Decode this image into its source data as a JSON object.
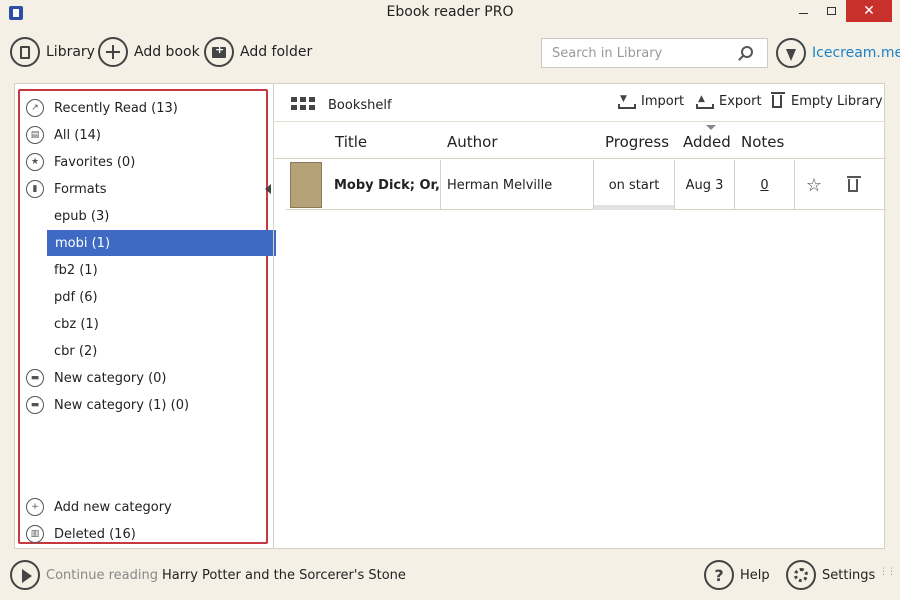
{
  "window": {
    "title": "Ebook reader PRO",
    "close_symbol": "✕"
  },
  "toolbar": {
    "library_label": "Library",
    "add_book_label": "Add book",
    "add_folder_label": "Add folder",
    "search_placeholder": "Search in Library",
    "brand_label": "Icecream.me"
  },
  "sidebar": {
    "items": [
      {
        "label": "Recently Read (13)",
        "icon": "share-icon"
      },
      {
        "label": "All (14)",
        "icon": "books-icon"
      },
      {
        "label": "Favorites (0)",
        "icon": "star-icon"
      },
      {
        "label": "Formats",
        "icon": "file-icon"
      },
      {
        "label": "epub (3)"
      },
      {
        "label": "mobi (1)"
      },
      {
        "label": "fb2 (1)"
      },
      {
        "label": "pdf (6)"
      },
      {
        "label": "cbz (1)"
      },
      {
        "label": "cbr (2)"
      },
      {
        "label": "New category (0)",
        "icon": "folder-icon"
      },
      {
        "label": "New category (1) (0)",
        "icon": "folder-icon"
      },
      {
        "label": "Add new category",
        "icon": "plus-icon"
      },
      {
        "label": "Deleted (16)",
        "icon": "trash-icon"
      }
    ],
    "selected_item": "mobi (1)"
  },
  "content": {
    "view_label": "Bookshelf",
    "import_label": "Import",
    "export_label": "Export",
    "empty_library_label": "Empty Library",
    "columns": [
      "Title",
      "Author",
      "Progress",
      "Added",
      "Notes"
    ],
    "books": [
      {
        "title": "Moby Dick; Or,",
        "author": "Herman Melville",
        "progress": "on start",
        "added": "Aug 3",
        "notes": "0"
      }
    ]
  },
  "statusbar": {
    "continue_label": "Continue reading",
    "current_book": "Harry Potter and the Sorcerer's Stone",
    "help_label": "Help",
    "settings_label": "Settings"
  },
  "colors": {
    "accent_selected": "#3f6ac4",
    "sidebar_highlight_border": "#c5383f",
    "close_button": "#c7302b",
    "brand_link": "#1a82c4",
    "background": "#f5f0e6"
  }
}
